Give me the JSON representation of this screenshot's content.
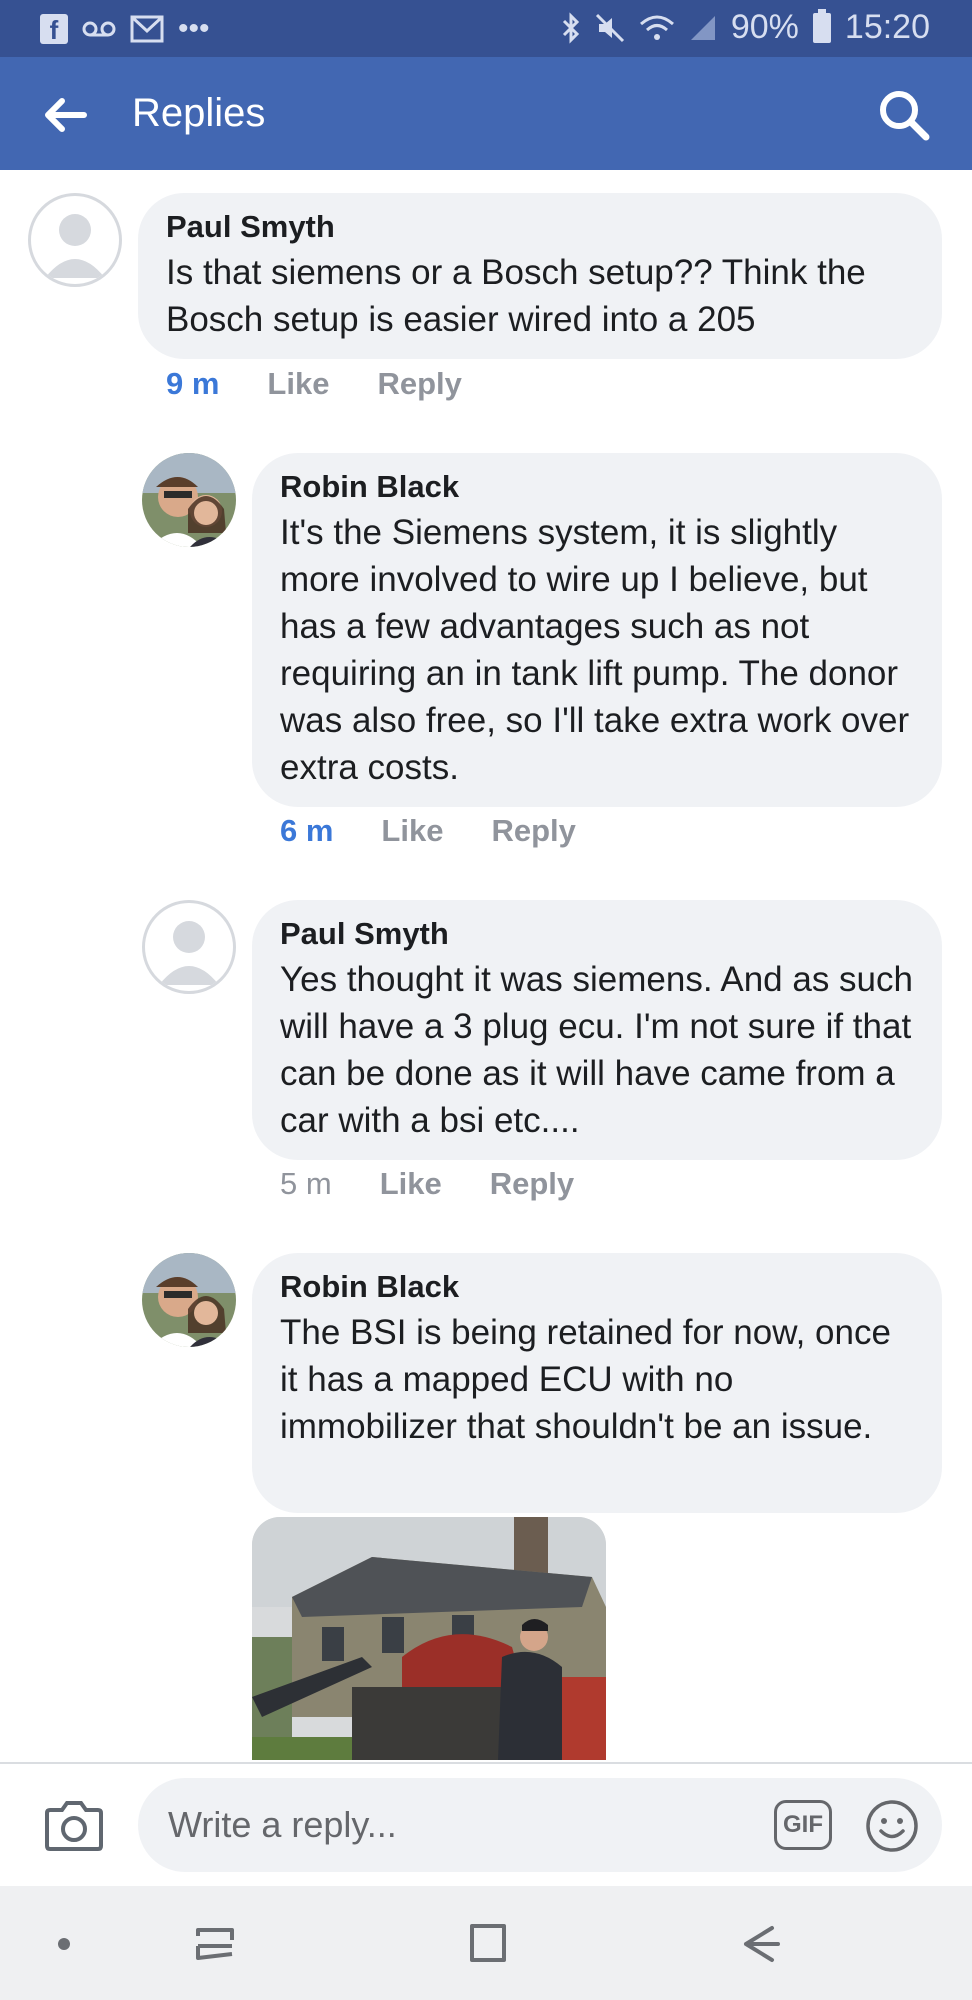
{
  "status_bar": {
    "battery": "90%",
    "time": "15:20",
    "dots": "•••",
    "left_icons": [
      "facebook-icon",
      "voicemail-icon",
      "gmail-icon",
      "more-notifications-icon"
    ],
    "right_icons": [
      "bluetooth-icon",
      "mute-icon",
      "wifi-icon",
      "signal-icon",
      "battery-icon"
    ]
  },
  "header": {
    "title": "Replies",
    "back_icon": "back-arrow-icon",
    "search_icon": "search-icon"
  },
  "comments": [
    {
      "author": "Paul Smyth",
      "text": "Is that siemens or a Bosch setup?? Think the Bosch setup is easier wired into a 205",
      "time": "9 m",
      "like": "Like",
      "reply": "Reply",
      "avatar": "generic-profile-avatar"
    },
    {
      "author": "Robin Black",
      "text": "It's the Siemens system, it is slightly more involved to wire up I believe, but has a few advantages such as not requiring an in tank lift pump. The donor was also free, so I'll take extra work over extra costs.",
      "time": "6 m",
      "like": "Like",
      "reply": "Reply",
      "avatar": "profile-photo"
    },
    {
      "author": "Paul Smyth",
      "text": "Yes thought it was siemens. And as such will have a 3 plug ecu. I'm not sure if that can be done as it will have came from a car with a bsi etc....",
      "time": "5 m",
      "like": "Like",
      "reply": "Reply",
      "avatar": "generic-profile-avatar"
    },
    {
      "author": "Robin Black",
      "text": "The BSI is being retained for now, once it has a mapped ECU with no immobilizer that shouldn't be an issue.",
      "avatar": "profile-photo",
      "attachment": "photo-attachment"
    }
  ],
  "composer": {
    "placeholder": "Write a reply...",
    "gif_label": "GIF",
    "camera_icon": "camera-icon",
    "emoji_icon": "emoji-icon"
  },
  "navigation": {
    "icons": [
      "nav-dot-icon",
      "recent-apps-icon",
      "home-icon",
      "back-icon"
    ]
  },
  "colors": {
    "status_bar": "#365192",
    "app_bar": "#4267b2",
    "bubble": "#f0f2f5",
    "recent_time": "#3b78d8",
    "meta_text": "#90949c"
  }
}
